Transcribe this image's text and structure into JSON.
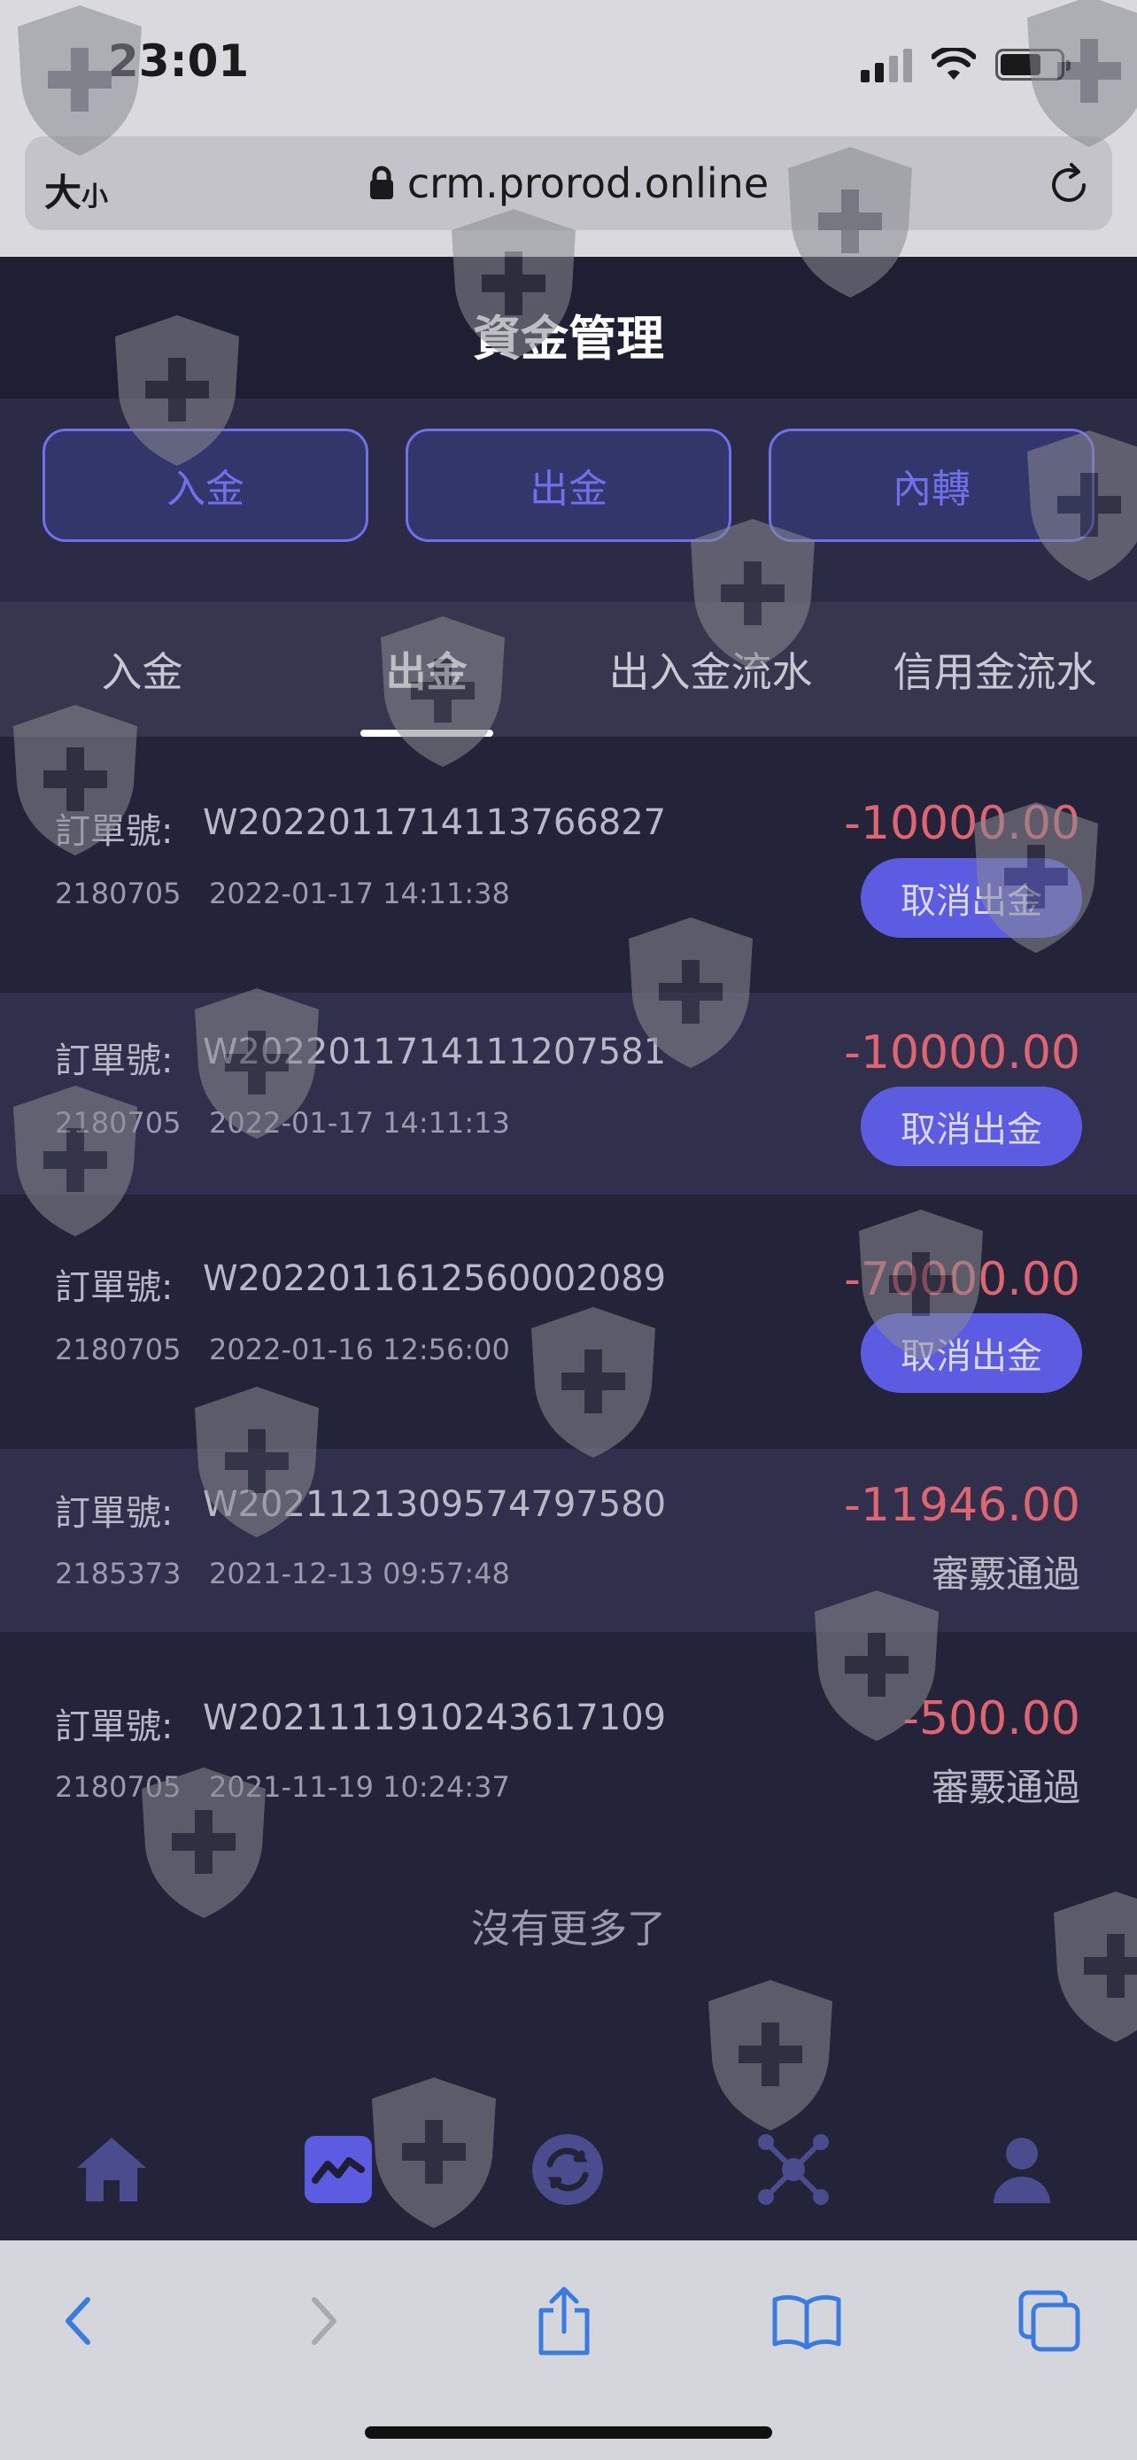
{
  "status_bar": {
    "time": "23:01"
  },
  "browser": {
    "text_size_label": "大",
    "text_size_small": "小",
    "url": "crm.prorod.online"
  },
  "header": {
    "title": "資金管理"
  },
  "actions": [
    {
      "label": "入金"
    },
    {
      "label": "出金"
    },
    {
      "label": "內轉"
    }
  ],
  "tabs": [
    {
      "label": "入金",
      "active": false
    },
    {
      "label": "出金",
      "active": true
    },
    {
      "label": "出入金流水",
      "active": false
    },
    {
      "label": "信用金流水",
      "active": false
    }
  ],
  "orders": [
    {
      "label": "訂單號:",
      "order_no": "W2022011714113766827",
      "user_id": "2180705",
      "time": "2022-01-17 14:11:38",
      "amount": "-10000.00",
      "action": "取消出金",
      "status": ""
    },
    {
      "label": "訂單號:",
      "order_no": "W2022011714111207581",
      "user_id": "2180705",
      "time": "2022-01-17 14:11:13",
      "amount": "-10000.00",
      "action": "取消出金",
      "status": ""
    },
    {
      "label": "訂單號:",
      "order_no": "W2022011612560002089",
      "user_id": "2180705",
      "time": "2022-01-16 12:56:00",
      "amount": "-70000.00",
      "action": "取消出金",
      "status": ""
    },
    {
      "label": "訂單號:",
      "order_no": "W2021121309574797580",
      "user_id": "2185373",
      "time": "2021-12-13 09:57:48",
      "amount": "-11946.00",
      "action": "",
      "status": "審覈通過"
    },
    {
      "label": "訂單號:",
      "order_no": "W2021111910243617109",
      "user_id": "2180705",
      "time": "2021-11-19 10:24:37",
      "amount": "-500.00",
      "action": "",
      "status": "審覈通過"
    }
  ],
  "footer_text": "沒有更多了",
  "bottom_nav": [
    {
      "icon": "home-icon",
      "active": false
    },
    {
      "icon": "chart-icon",
      "active": true
    },
    {
      "icon": "transfer-icon",
      "active": false
    },
    {
      "icon": "network-icon",
      "active": false
    },
    {
      "icon": "user-icon",
      "active": false
    }
  ],
  "colors": {
    "accent": "#5b5ce1",
    "negative": "#e06570",
    "background": "#23233a"
  }
}
